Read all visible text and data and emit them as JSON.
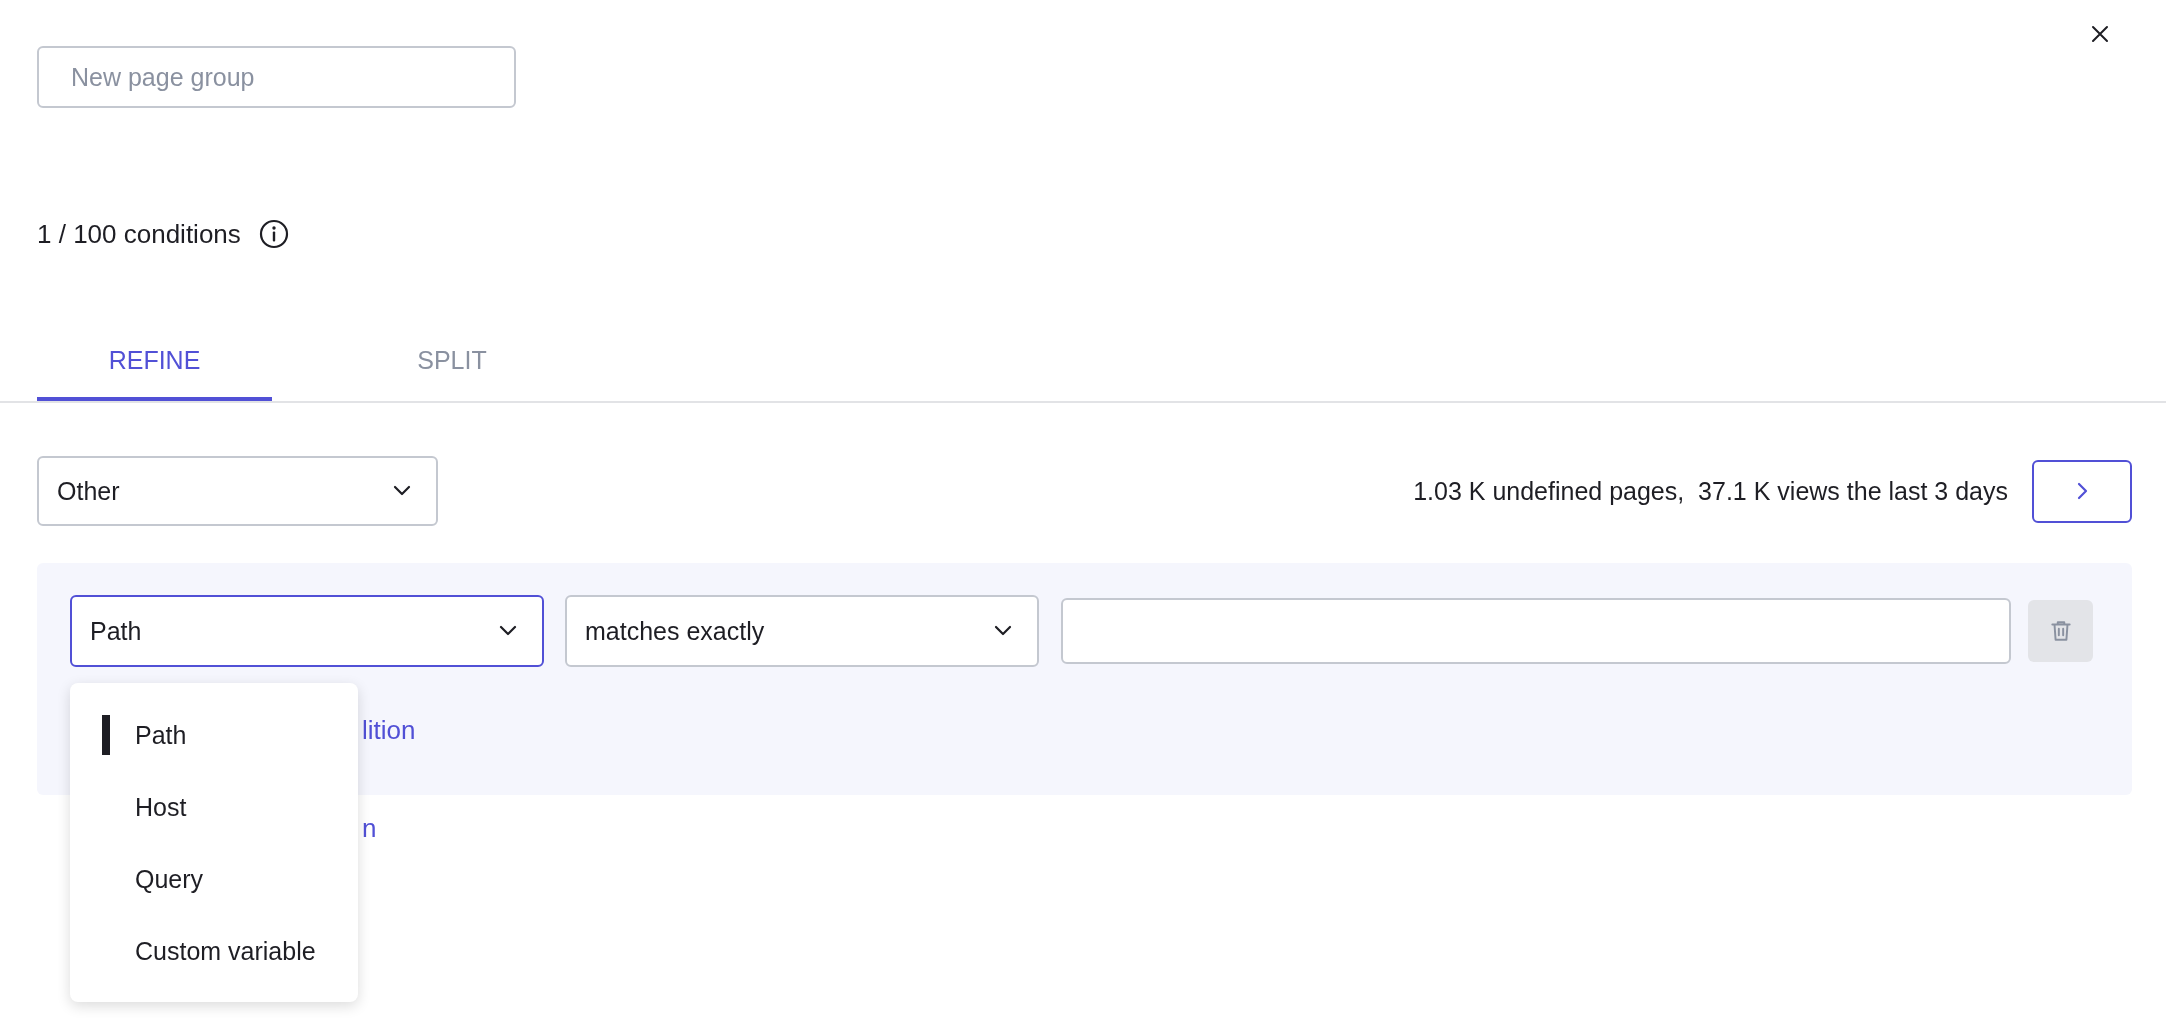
{
  "group_name": {
    "placeholder": "New page group"
  },
  "conditions": {
    "count": "1 / 100 conditions"
  },
  "tabs": [
    {
      "label": "REFINE",
      "selected": true
    },
    {
      "label": "SPLIT",
      "selected": false
    }
  ],
  "scope_select": {
    "value": "Other"
  },
  "summary": {
    "text": "1.03 K undefined pages,  37.1 K views the last 3 days"
  },
  "condition": {
    "field_select": {
      "value": "Path",
      "open": true
    },
    "operator_select": {
      "value": "matches exactly"
    }
  },
  "add_condition_link": "lition",
  "add_group_link": "n",
  "field_menu": {
    "items": [
      {
        "label": "Path",
        "selected": true
      },
      {
        "label": "Host",
        "selected": false
      },
      {
        "label": "Query",
        "selected": false
      },
      {
        "label": "Custom variable",
        "selected": false
      }
    ]
  }
}
